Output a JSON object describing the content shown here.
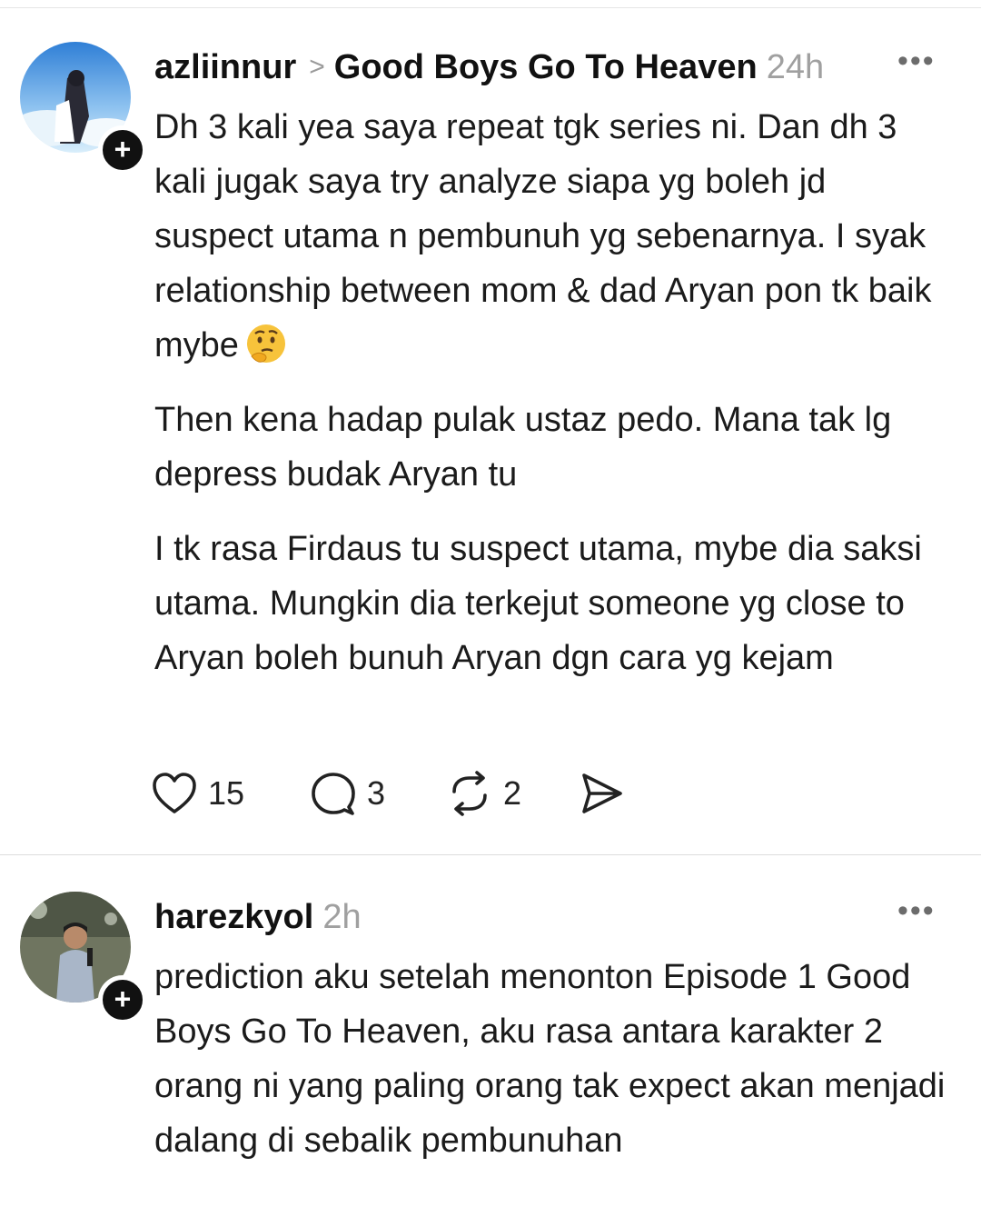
{
  "posts": [
    {
      "username": "azliinnur",
      "thread": "Good Boys Go To Heaven",
      "time": "24h",
      "more": "•••",
      "follow_symbol": "+",
      "paragraphs": [
        "Dh 3 kali yea saya repeat tgk series ni. Dan dh 3 kali jugak saya try analyze siapa yg boleh jd suspect utama n pembunuh yg sebenarnya. I syak relationship between mom & dad Aryan pon tk baik mybe",
        "Then kena hadap pulak ustaz pedo. Mana tak lg depress budak Aryan tu",
        "I tk rasa Firdaus tu suspect utama, mybe dia saksi utama. Mungkin dia terkejut someone yg close to Aryan boleh bunuh Aryan dgn cara yg kejam"
      ],
      "emoji": "thinking-face",
      "actions": {
        "likes": "15",
        "comments": "3",
        "reposts": "2"
      }
    },
    {
      "username": "harezkyol",
      "time": "2h",
      "more": "•••",
      "follow_symbol": "+",
      "paragraphs": [
        "prediction aku setelah menonton Episode 1 Good Boys Go To Heaven, aku rasa antara karakter 2 orang ni yang paling orang tak expect akan menjadi dalang di sebalik pembunuhan"
      ]
    }
  ]
}
